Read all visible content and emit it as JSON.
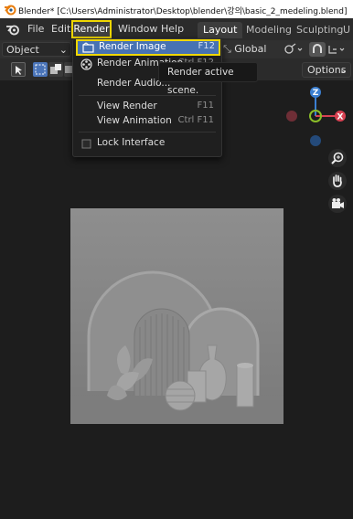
{
  "titlebar": {
    "title": "Blender* [C:\\Users\\Administrator\\Desktop\\blender\\강의\\basic_2_medeling.blend]"
  },
  "menubar": {
    "items": [
      "File",
      "Edit",
      "Render",
      "Window",
      "Help"
    ],
    "workspace_tabs": [
      "Layout",
      "Modeling",
      "Sculpting",
      "U"
    ],
    "active_workspace": "Layout",
    "highlight_color": "#f0d700"
  },
  "toolbar": {
    "mode": "Object Mode",
    "transform_orientation": "Global",
    "options_label": "Options"
  },
  "render_menu": {
    "items": [
      {
        "label": "Render Image",
        "shortcut": "F12",
        "icon": "render-image-icon",
        "highlighted": true
      },
      {
        "label": "Render Animation",
        "shortcut": "Ctrl F12",
        "icon": "render-animation-icon"
      },
      {
        "label": "Render Audio...",
        "shortcut": ""
      },
      {
        "label": "View Render",
        "shortcut": "F11"
      },
      {
        "label": "View Animation",
        "shortcut": "Ctrl F11"
      },
      {
        "label": "Lock Interface",
        "shortcut": "",
        "icon": "checkbox-icon"
      }
    ],
    "highlight_bg": "#4772b3"
  },
  "tooltip": {
    "text": "Render active scene."
  },
  "gizmo": {
    "z": "Z",
    "x": "X"
  }
}
